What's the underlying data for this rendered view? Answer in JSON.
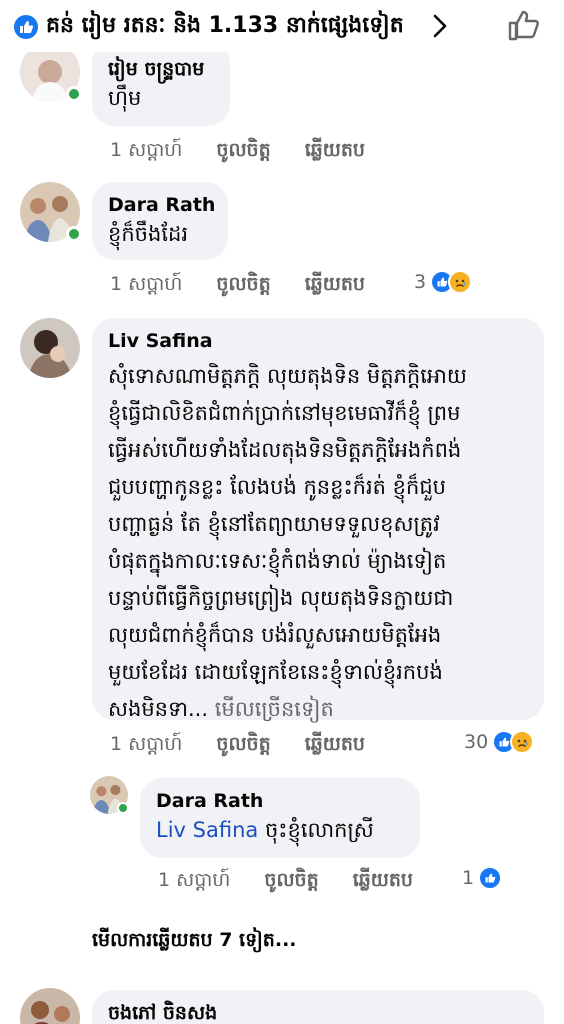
{
  "header": {
    "reaction_summary": "គន់ រៀម រតនៈ និង 1.133 នាក់ផ្សេងទៀត"
  },
  "comments": [
    {
      "name": "រៀម ចន្ទ្របាម",
      "text": "ហ៊ឹម",
      "time": "1 សប្តាហ៍",
      "like": "ចូលចិត្ត",
      "reply": "ឆ្លើយតប"
    },
    {
      "name": "Dara Rath",
      "text": "ខ្ញុំក៏ចឹងដែរ",
      "time": "1 សប្តាហ៍",
      "like": "ចូលចិត្ត",
      "reply": "ឆ្លើយតប",
      "reactions": "3"
    },
    {
      "name": "Liv Safina",
      "lines": [
        "សុំទោសណាមិត្តភក្តិ លុយតុងទិន មិត្តភក្តិអោយ",
        "ខ្ញុំធ្វើជាលិខិតជំពាក់ប្រាក់នៅមុខមេធាវីក៏ខ្ញុំ ព្រម",
        "ធ្វើអស់ហើយទាំងដែលតុងទិនមិត្តភក្តិអែងកំពង់",
        "ជួបបញ្ហាកូនខ្លះ លែងបង់ កូនខ្លះក៏រត់ ខ្ញុំក៏ជួប",
        "បញ្ហាធ្ងន់ តែ ខ្ញុំនៅតែព្យាយាមទទួលខុសត្រូវ",
        "បំផុតក្នុងកាលៈទេសៈខ្ញុំកំពង់ទាល់ ម៉្យាងទៀត",
        "បន្ទាប់ពីធ្វើកិច្ចព្រមព្រៀង លុយតុងទិនក្លាយជា",
        "លុយជំពាក់ខ្ញុំក៏បាន បង់រំលួសអោយមិត្តអែង",
        "មួយខែដែរ ដោយឡែកខែនេះខ្ញុំទាល់ខ្ញុំរកបង់"
      ],
      "last_line": "សងមិនទា...",
      "see_more": "មើលច្រើនទៀត",
      "time": "1 សប្តាហ៍",
      "like": "ចូលចិត្ត",
      "reply": "ឆ្លើយតប",
      "reactions": "30"
    },
    {
      "name": "Dara Rath",
      "mention": "Liv Safina",
      "text": "ចុះខ្ញុំលោកស្រី",
      "time": "1 សប្តាហ៍",
      "like": "ចូលចិត្ត",
      "reply": "ឆ្លើយតប",
      "reactions": "1"
    },
    {
      "name": "ចងភៅ ចិនសង"
    }
  ],
  "more_replies": "មើលការឆ្លើយតប 7 ទៀត...",
  "colors": {
    "accent": "#1877f2",
    "bubble": "#f0f2f5",
    "meta": "#65676b",
    "online": "#31a24c",
    "sad": "#f7b125"
  }
}
